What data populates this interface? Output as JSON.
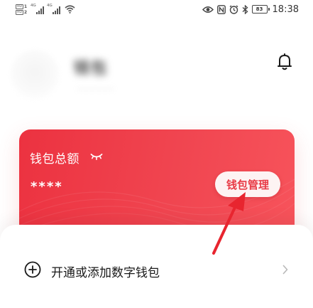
{
  "status_bar": {
    "sim1_badge": "HD",
    "sim1_num": "1",
    "sim2_badge": "HD",
    "sim2_num": "2",
    "net1": "4G",
    "net2": "4G",
    "battery": "83",
    "time": "18:38",
    "icons": [
      "eye-icon",
      "nfc-icon",
      "alarm-icon",
      "bluetooth-icon",
      "battery-icon"
    ]
  },
  "profile": {
    "name_blurred": "钱包",
    "sub_blurred": "· · · · · ·",
    "bell_icon": "bell-icon"
  },
  "wallet_card": {
    "title": "钱包总额",
    "amount": "****",
    "manage_button": "钱包管理",
    "eye_icon": "eye-closed-icon",
    "background_color": "#ee3a45"
  },
  "sheet": {
    "row_label": "开通或添加数字钱包",
    "row_icon": "plus-circle-icon",
    "chevron_icon": "chevron-right-icon"
  },
  "annotation": {
    "arrow_color": "#e8252f"
  }
}
